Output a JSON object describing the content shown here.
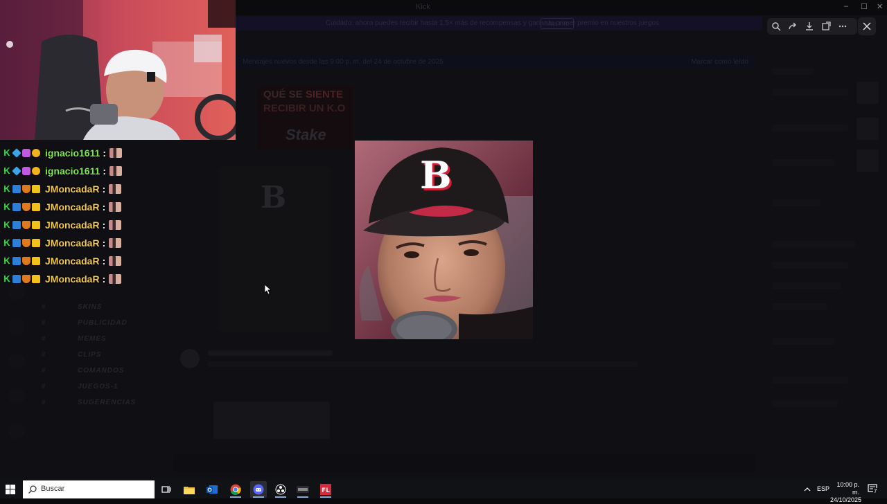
{
  "window": {
    "title": "Kick",
    "controls": [
      "–",
      "☐",
      "✕"
    ]
  },
  "background_app": {
    "notice_text": "Cuidado: ahora puedes recibir hasta 1,5× más de recompensas y ganar tu primer premio en nuestros juegos",
    "notice_button": "Más info",
    "channel_bar_text": "Mensajes nuevos desde las 9:00 p. m. del 24 de octubre de 2025",
    "channel_bar_right": "Marcar como leído",
    "stake_line1_a": "QUÉ SE ",
    "stake_line1_b": "SIENTE",
    "stake_line2_a": "RECIBIR UN ",
    "stake_line2_b": "K.O",
    "stake_logo": "Stake",
    "side_channels": [
      "SKINS",
      "PUBLICIDAD",
      "MEMES",
      "CLIPS",
      "COMANDOS",
      "JUEGOS-1",
      "SUGERENCIAS"
    ]
  },
  "viewer_toolbar": {
    "icons": [
      "zoom-icon",
      "share-icon",
      "download-icon",
      "open-external-icon",
      "more-icon"
    ],
    "close_icon": "close-icon"
  },
  "chat": {
    "messages": [
      {
        "user": "ignacio1611",
        "color": "#7ee84a",
        "badges": [
          "kick-icon",
          "cube-icon",
          "mask-icon",
          "coin-icon"
        ]
      },
      {
        "user": "ignacio1611",
        "color": "#7ee84a",
        "badges": [
          "kick-icon",
          "cube-icon",
          "mask-icon",
          "coin-icon"
        ]
      },
      {
        "user": "JMoncadaR",
        "color": "#f2c94c",
        "badges": [
          "kick-icon",
          "sword-icon",
          "shield-icon",
          "crown-icon"
        ]
      },
      {
        "user": "JMoncadaR",
        "color": "#f2c94c",
        "badges": [
          "kick-icon",
          "sword-icon",
          "shield-icon",
          "crown-icon"
        ]
      },
      {
        "user": "JMoncadaR",
        "color": "#f2c94c",
        "badges": [
          "kick-icon",
          "sword-icon",
          "shield-icon",
          "crown-icon"
        ]
      },
      {
        "user": "JMoncadaR",
        "color": "#f2c94c",
        "badges": [
          "kick-icon",
          "sword-icon",
          "shield-icon",
          "crown-icon"
        ]
      },
      {
        "user": "JMoncadaR",
        "color": "#f2c94c",
        "badges": [
          "kick-icon",
          "sword-icon",
          "shield-icon",
          "crown-icon"
        ]
      },
      {
        "user": "JMoncadaR",
        "color": "#f2c94c",
        "badges": [
          "kick-icon",
          "sword-icon",
          "shield-icon",
          "crown-icon"
        ]
      }
    ],
    "separator": ":"
  },
  "main_image": {
    "cap_letter": "B"
  },
  "taskbar": {
    "search_placeholder": "Buscar",
    "apps": [
      "task-view-icon",
      "file-explorer-icon",
      "outlook-icon",
      "chrome-icon",
      "discord-icon",
      "obs-icon",
      "app-icon",
      "fl-studio-icon"
    ],
    "language": "ESP",
    "time": "10:00 p. m.",
    "date": "24/10/2025",
    "notification_count": "7"
  },
  "colors": {
    "accent_kick_green": "#53fc18",
    "name_green": "#7ee84a",
    "name_gold": "#f2c94c",
    "taskbar_bg": "#101216"
  }
}
